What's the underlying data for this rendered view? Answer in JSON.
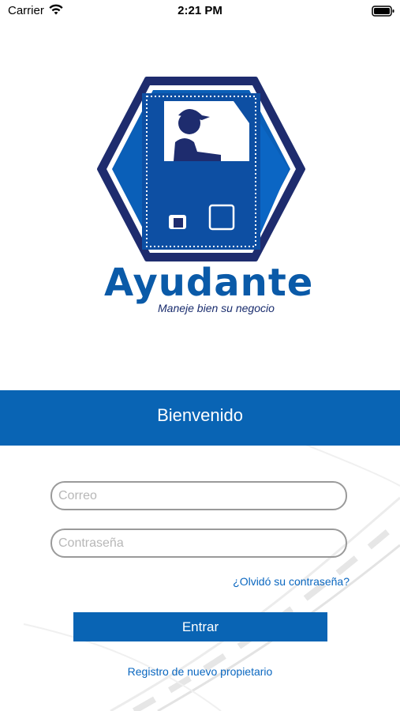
{
  "status_bar": {
    "carrier": "Carrier",
    "time": "2:21 PM"
  },
  "brand": {
    "name": "Ayudante",
    "tagline": "Maneje bien su negocio"
  },
  "welcome": {
    "title": "Bienvenido"
  },
  "login_form": {
    "email_placeholder": "Correo",
    "password_placeholder": "Contraseña",
    "forgot_password_label": "¿Olvidó su contraseña?",
    "submit_label": "Entrar",
    "register_label": "Registro de nuevo propietario"
  },
  "colors": {
    "primary": "#0964b4",
    "link": "#0a67c0",
    "logo_navy": "#1a2d6e"
  }
}
